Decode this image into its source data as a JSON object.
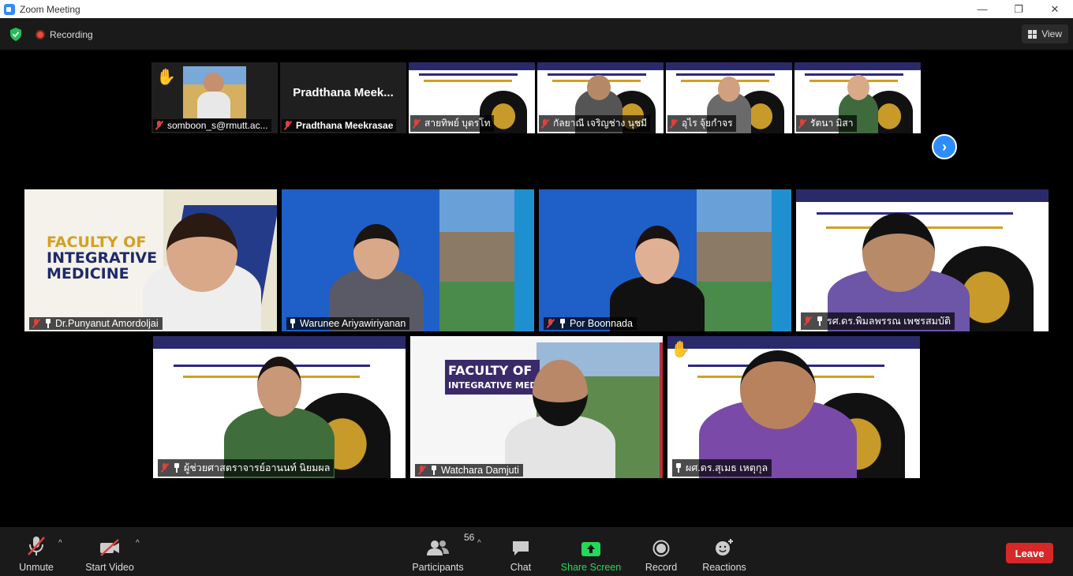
{
  "window": {
    "title": "Zoom Meeting",
    "minimize": "—",
    "maximize": "❐",
    "close": "✕"
  },
  "topbar": {
    "recording_label": "Recording",
    "view_label": "View"
  },
  "filmstrip": [
    {
      "name": "somboon_s@rmutt.ac..."
    },
    {
      "name": "Pradthana Meekrasae",
      "card_text": "Pradthana  Meek..."
    },
    {
      "name": "สายทิพย์  บุตรโท"
    },
    {
      "name": "กัลยาณี เจริญช่าง นุชมี"
    },
    {
      "name": "อุไร จุ้ยกำจร"
    },
    {
      "name": "รัตนา มิสา"
    }
  ],
  "grid": [
    {
      "name": "Dr.Punyanut Amordoljai",
      "slide_lines": [
        "FACULTY OF",
        "INTEGRATIVE",
        "MEDICINE"
      ]
    },
    {
      "name": "Warunee Ariyawiriyanan"
    },
    {
      "name": "Por Boonnada"
    },
    {
      "name": "รศ.ดร.พิมลพรรณ เพชรสมบัติ"
    },
    {
      "name": "ผู้ช่วยศาสตราจารย์อานนท์ นิยมผล"
    },
    {
      "name": "Watchara Damjuti",
      "slide_lines": [
        "FACULTY OF",
        "INTEGRATIVE MEDI"
      ]
    },
    {
      "name": "ผศ.ดร.สุเมธ เหตุกุล"
    }
  ],
  "toolbar": {
    "unmute": "Unmute",
    "start_video": "Start Video",
    "participants": "Participants",
    "participants_count": "56",
    "chat": "Chat",
    "share_screen": "Share Screen",
    "record": "Record",
    "reactions": "Reactions",
    "leave": "Leave"
  },
  "colors": {
    "accent": "#2d8cff",
    "share_green": "#23d959",
    "active_speaker": "#d7e25a",
    "leave_red": "#d62828",
    "mute_red": "#e04040"
  }
}
